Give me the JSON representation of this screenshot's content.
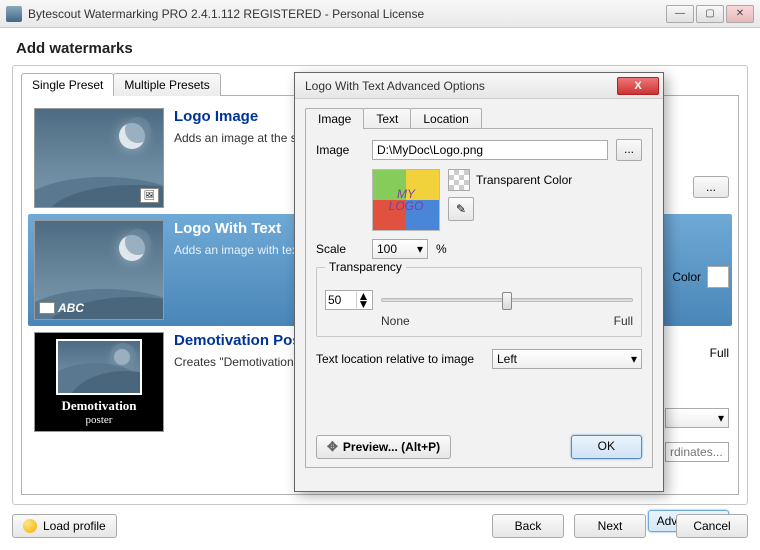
{
  "window": {
    "title": "Bytescout Watermarking PRO 2.4.1.112 REGISTERED - Personal License"
  },
  "page": {
    "heading": "Add watermarks"
  },
  "tabs": {
    "single": "Single Preset",
    "multiple": "Multiple Presets"
  },
  "presets": [
    {
      "title": "Logo Image",
      "desc": "Adds an image at the selected location (see Placement) with optional transparency"
    },
    {
      "title": "Logo With Text",
      "desc": "Adds an image with text at the selected location (see Placement) with optional transparency"
    },
    {
      "title": "Demotivation Poster",
      "desc": "Creates \"Demotivation Poster\""
    }
  ],
  "thumb_text": {
    "abc": "ABC",
    "dm1": "Demotivation",
    "dm2": "poster",
    "logo1": "MY",
    "logo2": "LOGO"
  },
  "right": {
    "color": "Color",
    "full": "Full",
    "advanced": "Advanced...",
    "coords_placeholder": "rdinates..."
  },
  "footer": {
    "load": "Load profile",
    "back": "Back",
    "next": "Next",
    "cancel": "Cancel"
  },
  "dialog": {
    "title": "Logo With Text Advanced Options",
    "tabs": {
      "image": "Image",
      "text": "Text",
      "location": "Location"
    },
    "image_label": "Image",
    "image_path": "D:\\MyDoc\\Logo.png",
    "browse": "...",
    "transparent_color": "Transparent Color",
    "scale_label": "Scale",
    "scale_value": "100",
    "scale_suffix": "%",
    "transparency_label": "Transparency",
    "transparency_value": "50",
    "slider_none": "None",
    "slider_full": "Full",
    "textloc_label": "Text location relative to image",
    "textloc_value": "Left",
    "preview": "Preview... (Alt+P)",
    "ok": "OK"
  }
}
